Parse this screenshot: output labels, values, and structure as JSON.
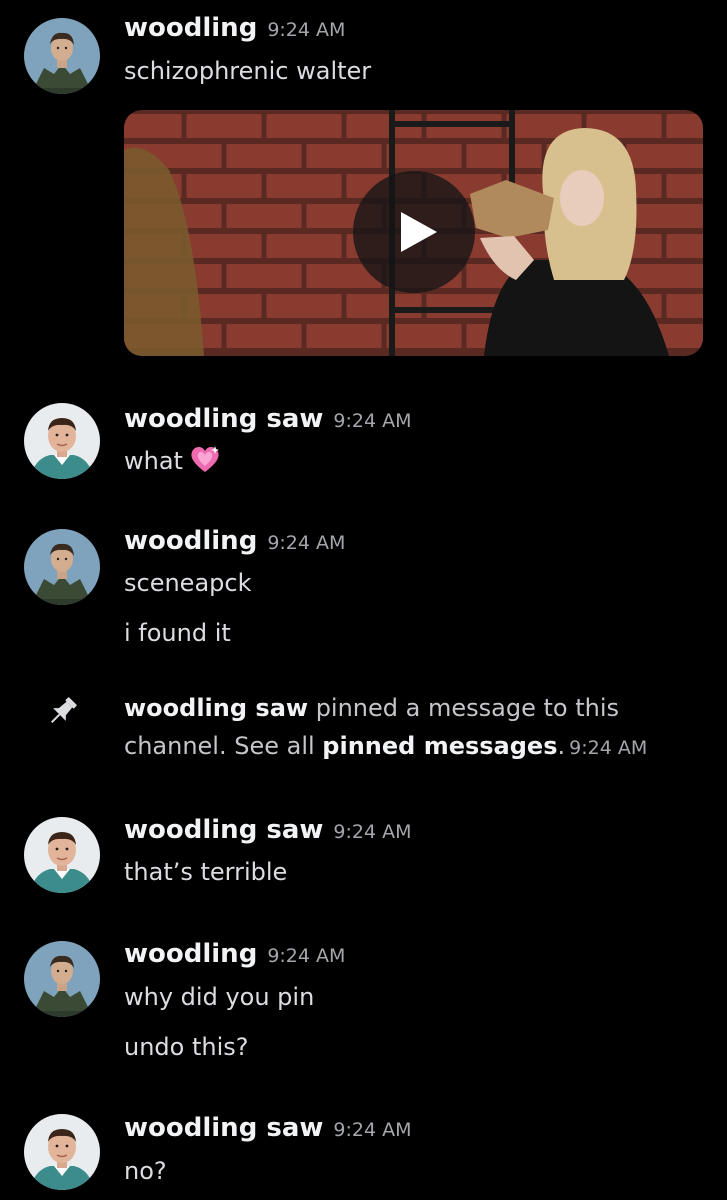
{
  "messages": [
    {
      "author": "woodling",
      "time": "9:24 AM",
      "lines": [
        "schizophrenic walter"
      ],
      "has_video": true
    },
    {
      "author": "woodling saw",
      "time": "9:24 AM",
      "lines": [
        "what"
      ],
      "emoji": "heart-sparkle"
    },
    {
      "author": "woodling",
      "time": "9:24 AM",
      "lines": [
        "sceneapck",
        "i found it"
      ]
    },
    {
      "author": "woodling saw",
      "time": "9:24 AM",
      "lines": [
        "that’s terrible"
      ]
    },
    {
      "author": "woodling",
      "time": "9:24 AM",
      "lines": [
        "why did you pin",
        "undo this?"
      ]
    },
    {
      "author": "woodling saw",
      "time": "9:24 AM",
      "lines": [
        "no?"
      ]
    }
  ],
  "system": {
    "actor": "woodling saw",
    "text_before_link": " pinned a message to this channel. See all ",
    "link_text": "pinned messages",
    "text_after_link": ".",
    "time": "9:24 AM",
    "icon": "pin-icon"
  },
  "colors": {
    "background": "#000000",
    "username": "#f2f3f5",
    "message_text": "#dcdde1",
    "timestamp": "#a3a6aa",
    "avatar1_bg": "#7fa3bc",
    "avatar2_bg": "#e9ecef"
  }
}
